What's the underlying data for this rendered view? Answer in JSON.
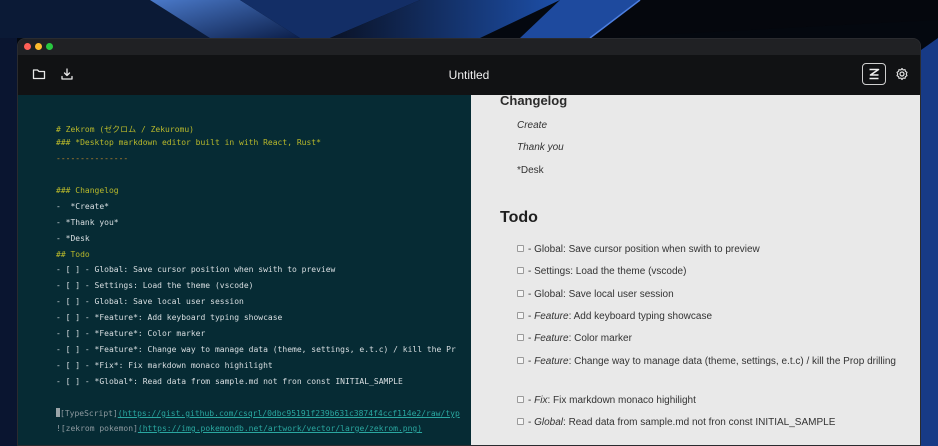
{
  "window": {
    "title": "Untitled"
  },
  "toolbar": {
    "open_icon": "folder-icon",
    "export_icon": "download-icon",
    "mode_icon": "zekrom-logo-icon",
    "settings_icon": "gear-icon"
  },
  "editor": {
    "lines": [
      "# Zekrom (ゼクロム / Zekuromu)",
      "### *Desktop markdown editor built in with React, Rust*",
      "---------------",
      "### Changelog",
      "-  *Create*",
      "- *Thank you*",
      "- *Desk",
      "## Todo",
      "- [ ] - Global: Save cursor position when swith to preview",
      "- [ ] - Settings: Load the theme (vscode)",
      "- [ ] - Global: Save local user session",
      "- [ ] - *Feature*: Add keyboard typing showcase",
      "- [ ] - *Feature*: Color marker",
      "- [ ] - *Feature*: Change way to manage data (theme, settings, e.t.c) / kill the Pr",
      "- [ ] - *Fix*: Fix markdown monaco highilight",
      "- [ ] - *Global*: Read data from sample.md not fron const INITIAL_SAMPLE"
    ],
    "link1_text": "[TypeScript]",
    "link1_url": "(https://gist.github.com/csqrl/0dbc95191f239b631c3874f4ccf114e2/raw/typ",
    "link2_text": "![zekrom pokemon]",
    "link2_url": "(https://img.pokemondb.net/artwork/vector/large/zekrom.png)"
  },
  "preview": {
    "changelog_heading": "Changelog",
    "changelog_items": [
      "Create",
      "Thank you",
      "*Desk"
    ],
    "todo_heading": "Todo",
    "todos": [
      {
        "prefix": "- Global: Save cursor position when swith to preview",
        "em": "",
        "rest": ""
      },
      {
        "prefix": "- Settings: Load the theme (vscode)",
        "em": "",
        "rest": ""
      },
      {
        "prefix": "- Global: Save local user session",
        "em": "",
        "rest": ""
      },
      {
        "prefix": "- ",
        "em": "Feature",
        "rest": ": Add keyboard typing showcase"
      },
      {
        "prefix": "- ",
        "em": "Feature",
        "rest": ": Color marker"
      },
      {
        "prefix": "- ",
        "em": "Feature",
        "rest": ": Change way to manage data (theme, settings, e.t.c) / kill the Prop drilling"
      },
      {
        "prefix": "- ",
        "em": "Fix",
        "rest": ": Fix markdown monaco highilight"
      },
      {
        "prefix": "- ",
        "em": "Global",
        "rest": ": Read data from sample.md not fron const INITIAL_SAMPLE"
      }
    ]
  },
  "colors": {
    "editor_bg": "#062b34",
    "preview_bg": "#e9e9e9",
    "heading_yellow": "#b8b82b",
    "link_cyan": "#2aa7a0"
  }
}
